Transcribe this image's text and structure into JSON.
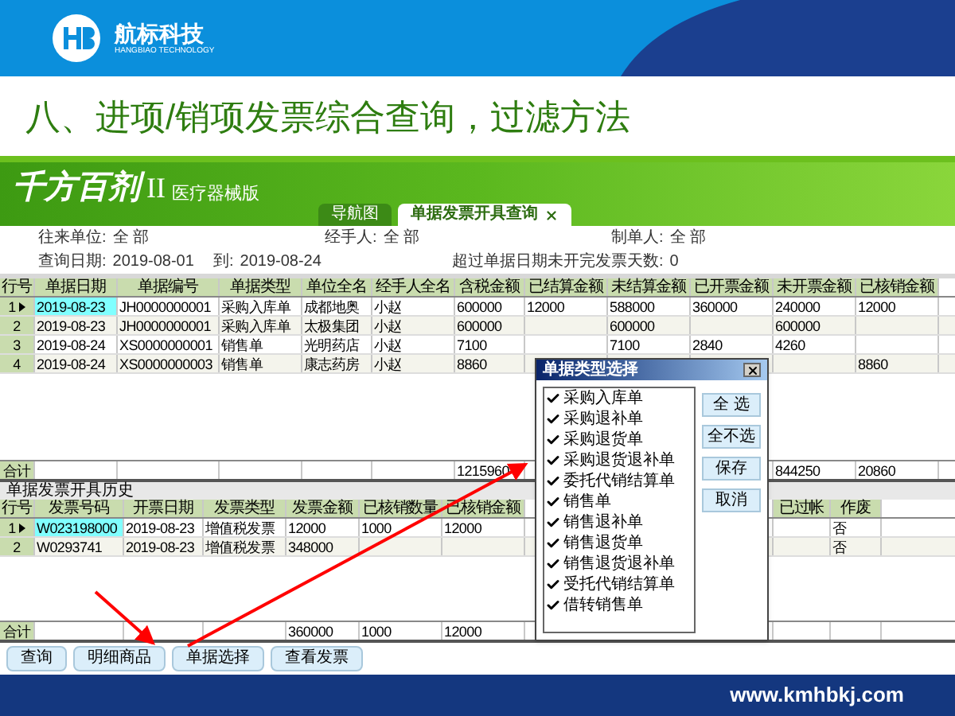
{
  "slide": {
    "brand": "航标科技",
    "brand_sub": "HANGBIAO TECHNOLOGY",
    "title": "八、进项/销项发票综合查询，过滤方法",
    "footer": "www.kmhbkj.com"
  },
  "app": {
    "logo": "千方百剂",
    "logo_mark": "II",
    "edition": "医疗器械版",
    "tabs": [
      {
        "label": "导航图",
        "selected": false
      },
      {
        "label": "单据发票开具查询",
        "selected": true
      }
    ]
  },
  "filters": [
    [
      {
        "label": "往来单位:",
        "value": "全 部"
      },
      {
        "label": "经手人:",
        "value": "全 部"
      },
      {
        "label": "制单人:",
        "value": "全 部"
      }
    ],
    [
      {
        "label": "查询日期:",
        "value": "2019-08-01"
      },
      {
        "label": "到:",
        "value": "2019-08-24"
      },
      {
        "label": "超过单据日期未开完发票天数:",
        "value": "0"
      }
    ]
  ],
  "documents": {
    "columns": [
      "行号",
      "单据日期",
      "单据编号",
      "单据类型",
      "单位全名",
      "经手人全名",
      "含税金额",
      "已结算金额",
      "未结算金额",
      "已开票金额",
      "未开票金额",
      "已核销金额"
    ],
    "rows": [
      {
        "selected": true,
        "row_no": "1",
        "date": "2019-08-23",
        "number": "JH0000000001",
        "type": "采购入库单",
        "company": "成都地奥",
        "handler": "小赵",
        "amount": "600000",
        "settled": "12000",
        "unsettled": "588000",
        "invoiced": "360000",
        "uninvoiced": "240000",
        "written_off": "12000"
      },
      {
        "selected": false,
        "row_no": "2",
        "date": "2019-08-23",
        "number": "JH0000000001",
        "type": "采购入库单",
        "company": "太极集团",
        "handler": "小赵",
        "amount": "600000",
        "unsettled": "600000",
        "uninvoiced": "600000"
      },
      {
        "selected": false,
        "row_no": "3",
        "date": "2019-08-24",
        "number": "XS0000000001",
        "type": "销售单",
        "company": "光明药店",
        "handler": "小赵",
        "amount": "7100",
        "unsettled": "7100",
        "invoiced": "2840",
        "uninvoiced": "4260"
      },
      {
        "selected": false,
        "row_no": "4",
        "date": "2019-08-24",
        "number": "XS0000000003",
        "type": "销售单",
        "company": "康志药房",
        "handler": "小赵",
        "amount": "8860",
        "written_off": "8860"
      }
    ],
    "total": {
      "row_no": "合计",
      "amount": "1215960",
      "uninvoiced": "844250",
      "written_off": "20860"
    }
  },
  "history": {
    "title": "单据发票开具历史",
    "columns": [
      "行号",
      "发票号码",
      "开票日期",
      "发票类型",
      "发票金额",
      "已核销数量",
      "已核销金额",
      "已过帐",
      "作废"
    ],
    "rows": [
      {
        "selected": true,
        "row_no": "1",
        "invoice_no": "W023198000",
        "date": "2019-08-23",
        "type": "增值税发票",
        "amount": "12000",
        "written_off_qty": "1000",
        "written_off": "12000",
        "void": "否"
      },
      {
        "selected": false,
        "row_no": "2",
        "invoice_no": "W0293741",
        "date": "2019-08-23",
        "type": "增值税发票",
        "amount": "348000",
        "void": "否"
      }
    ],
    "total": {
      "row_no": "合计",
      "amount": "360000",
      "written_off_qty": "1000",
      "written_off": "12000"
    }
  },
  "dialog": {
    "title": "单据类型选择",
    "items": [
      {
        "label": "采购入库单",
        "checked": true
      },
      {
        "label": "采购退补单",
        "checked": true
      },
      {
        "label": "采购退货单",
        "checked": true
      },
      {
        "label": "采购退货退补单",
        "checked": true
      },
      {
        "label": "委托代销结算单",
        "checked": true
      },
      {
        "label": "销售单",
        "checked": true
      },
      {
        "label": "销售退补单",
        "checked": true
      },
      {
        "label": "销售退货单",
        "checked": true
      },
      {
        "label": "销售退货退补单",
        "checked": true
      },
      {
        "label": "受托代销结算单",
        "checked": true
      },
      {
        "label": "借转销售单",
        "checked": true
      }
    ],
    "buttons": [
      "全 选",
      "全不选",
      "保存",
      "取消"
    ]
  },
  "buttons": [
    "查询",
    "明细商品",
    "单据选择",
    "查看发票"
  ]
}
